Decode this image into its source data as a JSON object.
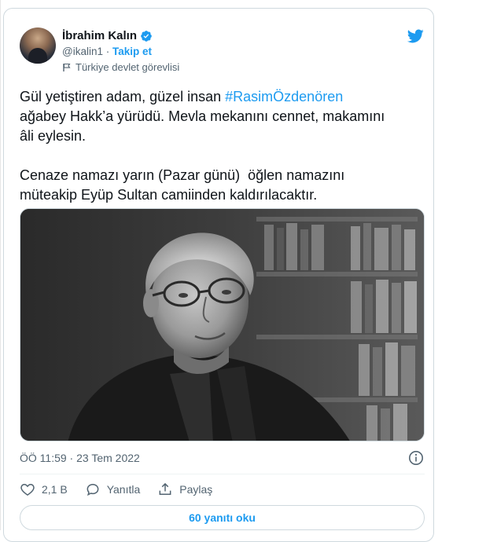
{
  "author": {
    "name": "İbrahim Kalın",
    "handle": "@ikalin1",
    "separator": "·",
    "follow_label": "Takip et",
    "account_label": "Türkiye devlet görevlisi"
  },
  "tweet": {
    "text_part1": "Gül yetiştiren adam, güzel insan ",
    "hashtag": "#RasimÖzdenören",
    "text_part2": "\nağabey Hakk’a yürüdü. Mevla mekanını cennet, makamını\nâli eylesin.\n\nCenaze namazı yarın (Pazar günü)  öğlen namazını\nmüteakip Eyüp Sultan camiinden kaldırılacaktır.",
    "timestamp": "ÖÖ 11:59 · 23 Tem 2022"
  },
  "actions": {
    "like_count": "2,1 B",
    "reply_label": "Yanıtla",
    "share_label": "Paylaş"
  },
  "replies_button_label": "60 yanıtı oku",
  "icons": {
    "brand": "twitter-bird-icon",
    "verified": "verified-badge-icon",
    "label": "flag-icon",
    "info": "info-icon",
    "like": "heart-icon",
    "reply": "speech-bubble-icon",
    "share": "share-upload-icon"
  },
  "colors": {
    "accent": "#1d9bf0",
    "text": "#0f1419",
    "secondary": "#536471",
    "border": "#cfd9de"
  }
}
